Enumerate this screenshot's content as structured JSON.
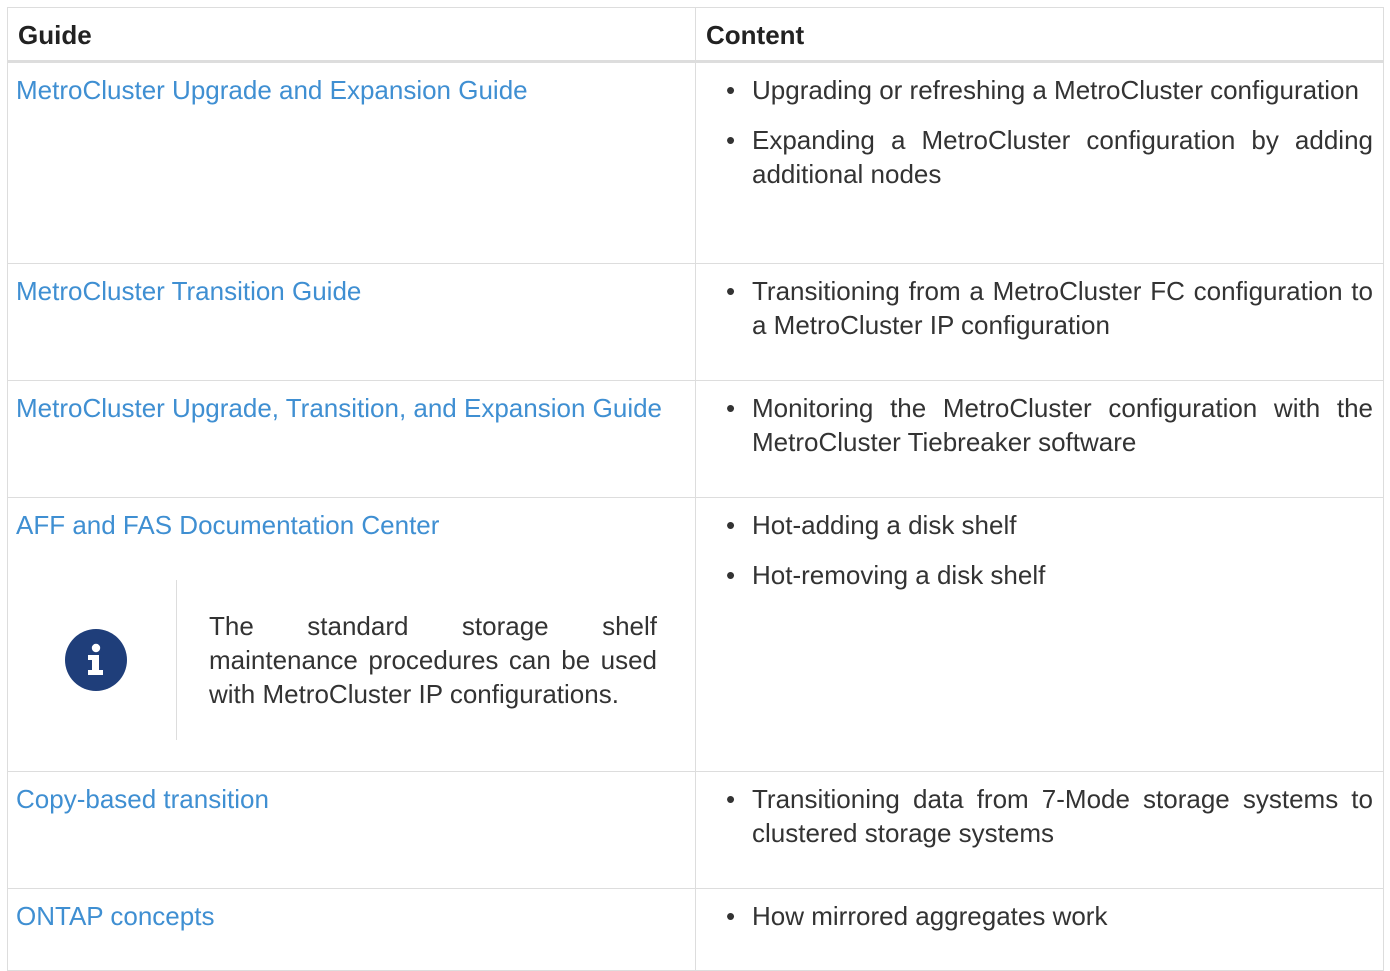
{
  "table": {
    "headers": {
      "guide": "Guide",
      "content": "Content"
    },
    "rows": [
      {
        "guide": "MetroCluster Upgrade and Expansion Guide",
        "items": [
          "Upgrading or refreshing a MetroCluster configuration",
          "Expanding a MetroCluster configuration by adding additional nodes"
        ]
      },
      {
        "guide": "MetroCluster Transition Guide",
        "items": [
          "Transitioning from a MetroCluster FC configuration to a MetroCluster IP configuration"
        ]
      },
      {
        "guide": "MetroCluster Upgrade, Transition, and Expansion Guide",
        "items": [
          "Monitoring the MetroCluster configuration with the MetroCluster Tiebreaker software"
        ]
      },
      {
        "guide": "AFF and FAS Documentation Center",
        "note": "The standard storage shelf maintenance procedures can be used with MetroCluster IP configurations.",
        "items": [
          "Hot-adding a disk shelf",
          "Hot-removing a disk shelf"
        ]
      },
      {
        "guide": "Copy-based transition",
        "items": [
          "Transitioning data from 7-Mode storage systems to clustered storage systems"
        ]
      },
      {
        "guide": "ONTAP concepts",
        "items": [
          "How mirrored aggregates work"
        ]
      }
    ]
  },
  "icons": {
    "note_icon": "info-icon"
  },
  "colors": {
    "link": "#3f8fd2",
    "info_icon_bg": "#1f3e7a",
    "border": "#dddddd"
  }
}
